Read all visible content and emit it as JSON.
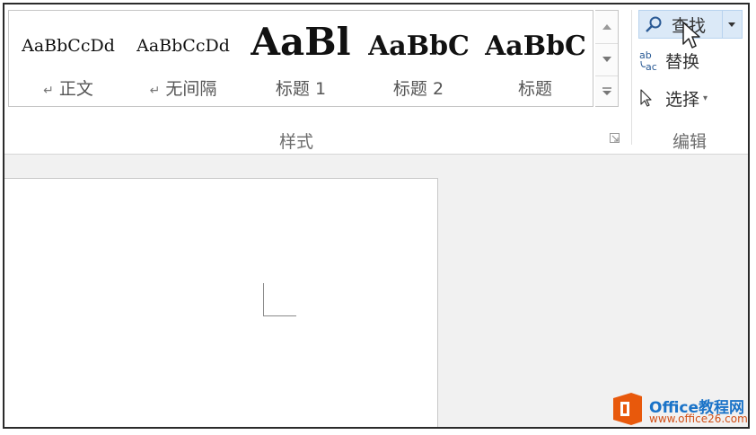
{
  "ribbon": {
    "styles_group": {
      "label": "样式",
      "tiles": [
        {
          "preview": "AaBbCcDd",
          "name": "正文",
          "para_mark": "↵"
        },
        {
          "preview": "AaBbCcDd",
          "name": "无间隔",
          "para_mark": "↵"
        },
        {
          "preview": "AaBl",
          "name": "标题 1"
        },
        {
          "preview": "AaBbC",
          "name": "标题 2"
        },
        {
          "preview": "AaBbC",
          "name": "标题"
        }
      ]
    },
    "editing_group": {
      "label": "编辑",
      "find_label": "查找",
      "replace_label": "替换",
      "select_label": "选择"
    }
  },
  "watermark": {
    "title": "Office教程网",
    "url": "www.office26.com"
  },
  "icons": {
    "find": "magnifier-icon",
    "replace": "replace-ab-ac-icon",
    "select": "pointer-arrow-icon",
    "mouse_cursor": "mouse-cursor-icon",
    "logo": "office-logo-icon"
  },
  "colors": {
    "find_highlight": "#dbe9f7",
    "accent_blue": "#1a73c8",
    "office_orange": "#e8590c"
  }
}
